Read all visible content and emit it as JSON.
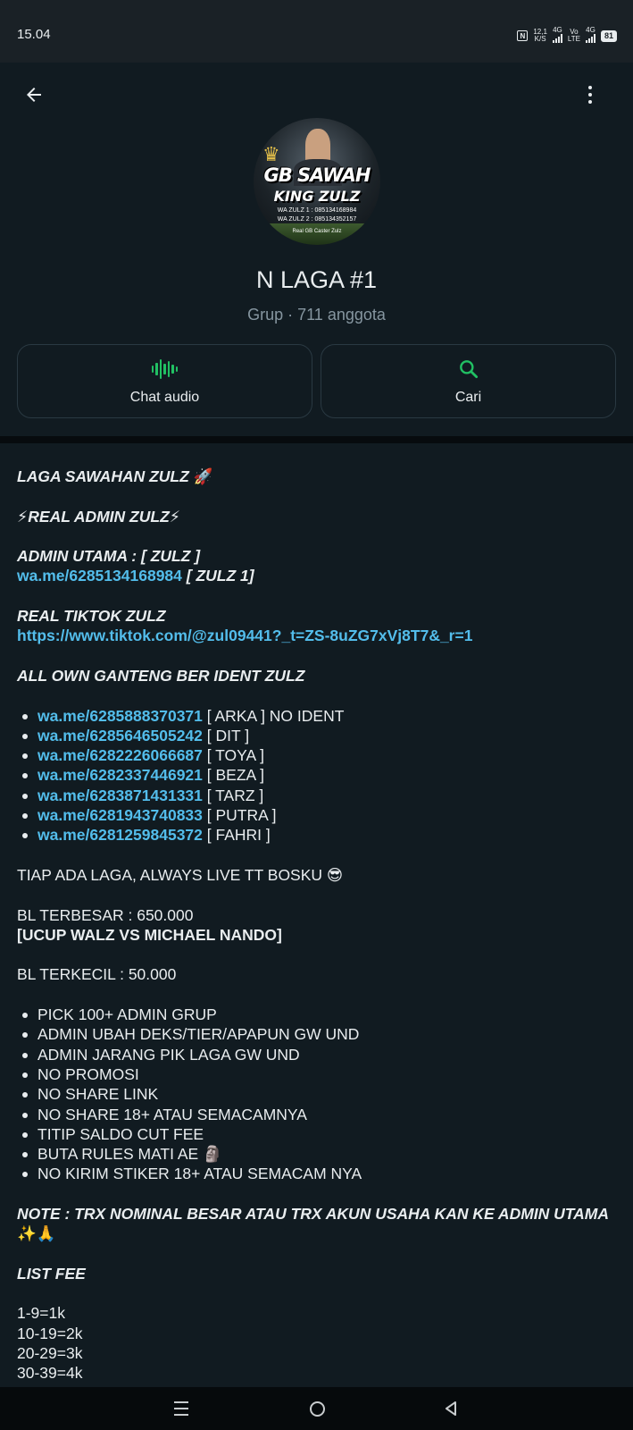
{
  "status_bar": {
    "time": "15.04",
    "nfc": "N",
    "speed": "12,1",
    "speed_unit": "K/S",
    "net1": "4G",
    "volte_top": "Vo",
    "volte_bottom": "LTE",
    "net2": "4G",
    "battery": "81"
  },
  "header": {
    "group_name": "N LAGA #1",
    "subtitle": "Grup · 711 anggota",
    "avatar": {
      "title_line1": "GB SAWAH",
      "title_line2": "KING ZULZ",
      "line1": "WA ZULZ 1 : 085134168984",
      "line2": "WA ZULZ 2 : 085134352157",
      "line3": "Real GB Caster Zulz"
    },
    "actions": [
      {
        "label": "Chat audio",
        "icon": "audio-wave-icon"
      },
      {
        "label": "Cari",
        "icon": "search-icon"
      }
    ]
  },
  "description": {
    "title": "LAGA SAWAHAN ZULZ",
    "title_emoji": "🚀",
    "real_admin": "REAL ADMIN ZULZ",
    "bolt": "⚡",
    "admin_utama_label": "ADMIN UTAMA : [ ZULZ ]",
    "admin_utama_link": "wa.me/6285134168984",
    "admin_utama_suffix": " [ ZULZ 1]",
    "tiktok_label": "REAL TIKTOK ZULZ",
    "tiktok_link": "https://www.tiktok.com/@zul09441?_t=ZS-8uZG7xVj8T7&_r=1",
    "own_label": "ALL OWN GANTENG BER IDENT ZULZ",
    "own_list": [
      {
        "link": "wa.me/6285888370371",
        "name": " [ ARKA ] NO IDENT"
      },
      {
        "link": "wa.me/6285646505242",
        "name": " [ DIT ]"
      },
      {
        "link": "wa.me/6282226066687",
        "name": " [ TOYA ]"
      },
      {
        "link": "wa.me/6282337446921",
        "name": " [ BEZA ]"
      },
      {
        "link": "wa.me/6283871431331",
        "name": " [ TARZ ]"
      },
      {
        "link": "wa.me/6281943740833",
        "name": " [ PUTRA ]"
      },
      {
        "link": "wa.me/6281259845372",
        "name": " [ FAHRI ]"
      }
    ],
    "live_text": "TIAP ADA LAGA, ALWAYS LIVE TT BOSKU",
    "live_emoji": "😎",
    "bl_terbesar": "BL TERBESAR : 650.000",
    "bl_terbesar_match": "[UCUP WALZ VS MICHAEL NANDO]",
    "bl_terkecil": "BL TERKECIL : 50.000",
    "rules": [
      "PICK 100+ ADMIN GRUP",
      "ADMIN UBAH DEKS/TIER/APAPUN GW UND",
      "ADMIN JARANG PIK LAGA GW UND",
      "NO PROMOSI",
      "NO SHARE LINK",
      "NO SHARE 18+ ATAU SEMACAMNYA",
      "TITIP SALDO CUT FEE",
      "BUTA RULES MATI AE",
      "NO KIRIM STIKER 18+ ATAU SEMACAM NYA"
    ],
    "rule_emoji": "🗿",
    "note": "NOTE : TRX NOMINAL BESAR ATAU TRX AKUN USAHA KAN KE ADMIN UTAMA",
    "note_emoji": "✨🙏",
    "fee_label": "LIST FEE",
    "fees": [
      "1-9=1k",
      "10-19=2k",
      "20-29=3k",
      "30-39=4k"
    ]
  },
  "colors": {
    "accent": "#21c063",
    "link": "#53bdeb",
    "background": "#111b21"
  }
}
